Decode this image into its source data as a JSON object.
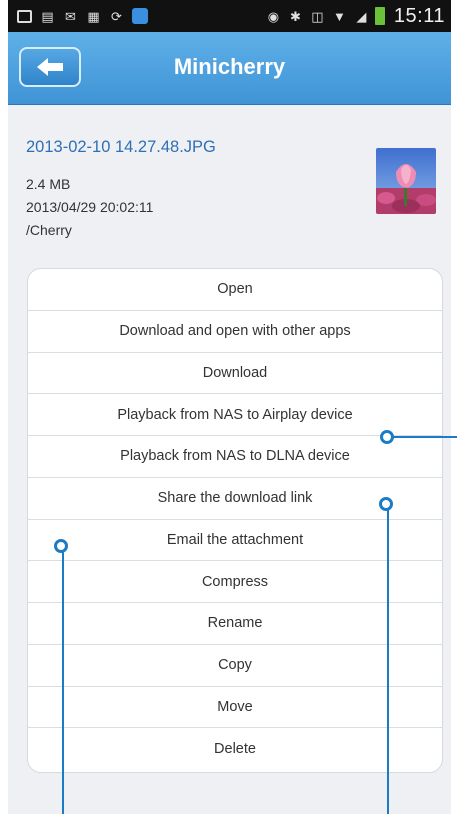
{
  "status_bar": {
    "time": "15:11",
    "icons": [
      "mail-icon",
      "document-icon",
      "envelope-icon",
      "calendar-icon",
      "sync-icon",
      "app-icon",
      "vibrate-icon",
      "bluetooth-icon",
      "nfc-icon",
      "wifi-icon",
      "signal-icon",
      "battery-icon"
    ]
  },
  "app_bar": {
    "title": "Minicherry",
    "back_icon": "arrow-left-icon"
  },
  "file": {
    "name": "2013-02-10 14.27.48.JPG",
    "size": "2.4 MB",
    "modified": "2013/04/29 20:02:11",
    "path": "/Cherry",
    "thumbnail": "tulip-photo"
  },
  "menu": {
    "items": [
      "Open",
      "Download and open with other apps",
      "Download",
      "Playback from NAS to Airplay device",
      "Playback from NAS to DLNA device",
      "Share the download link",
      "Email the attachment",
      "Compress",
      "Rename",
      "Copy",
      "Move",
      "Delete"
    ]
  },
  "colors": {
    "app_bar": "#4aa0de",
    "filename": "#2f6fb6",
    "callout": "#1b7cc5"
  }
}
